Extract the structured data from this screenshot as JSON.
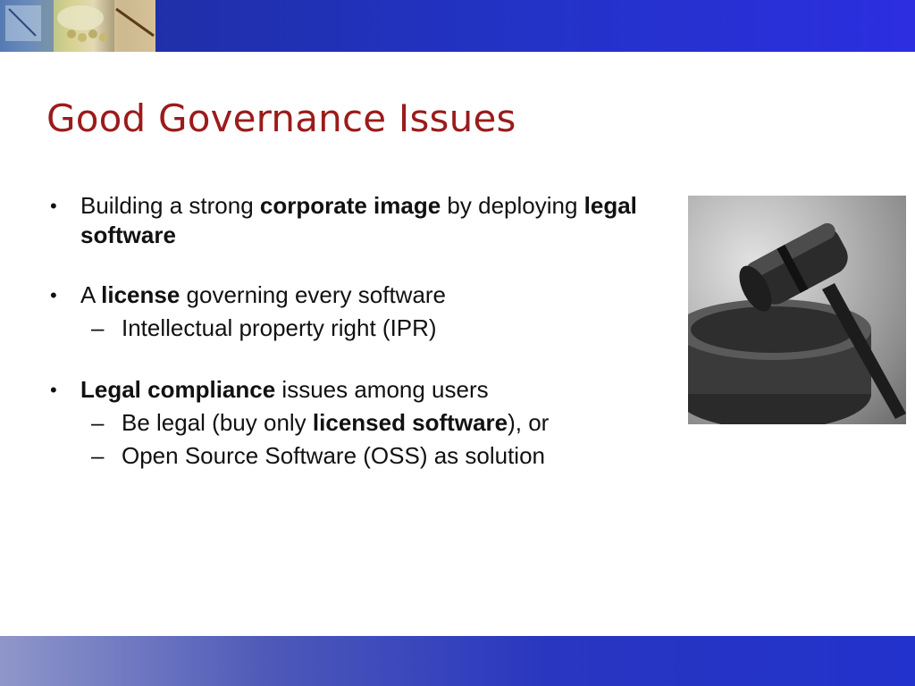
{
  "slide": {
    "title": "Good Governance Issues",
    "bullets": [
      {
        "marker": "•",
        "parts": [
          "Building a strong ",
          "corporate image",
          " by deploying ",
          "legal software"
        ]
      },
      {
        "marker": "•",
        "parts": [
          "A ",
          "license",
          " governing every software"
        ],
        "subs": [
          {
            "marker": "–",
            "text": "Intellectual property right (IPR)"
          }
        ]
      },
      {
        "marker": "•",
        "parts": [
          "Legal compliance",
          " issues among users"
        ],
        "subs": [
          {
            "marker": "–",
            "parts": [
              "Be legal (buy only ",
              "licensed software",
              "), or"
            ]
          },
          {
            "marker": "–",
            "text": "Open Source Software (OSS) as solution"
          }
        ]
      }
    ]
  },
  "colors": {
    "title": "#9b1b1b",
    "bar": "#2333c8",
    "text": "#111111"
  },
  "images": {
    "header": "office-photo-collage",
    "gavel": "gavel-photo"
  }
}
